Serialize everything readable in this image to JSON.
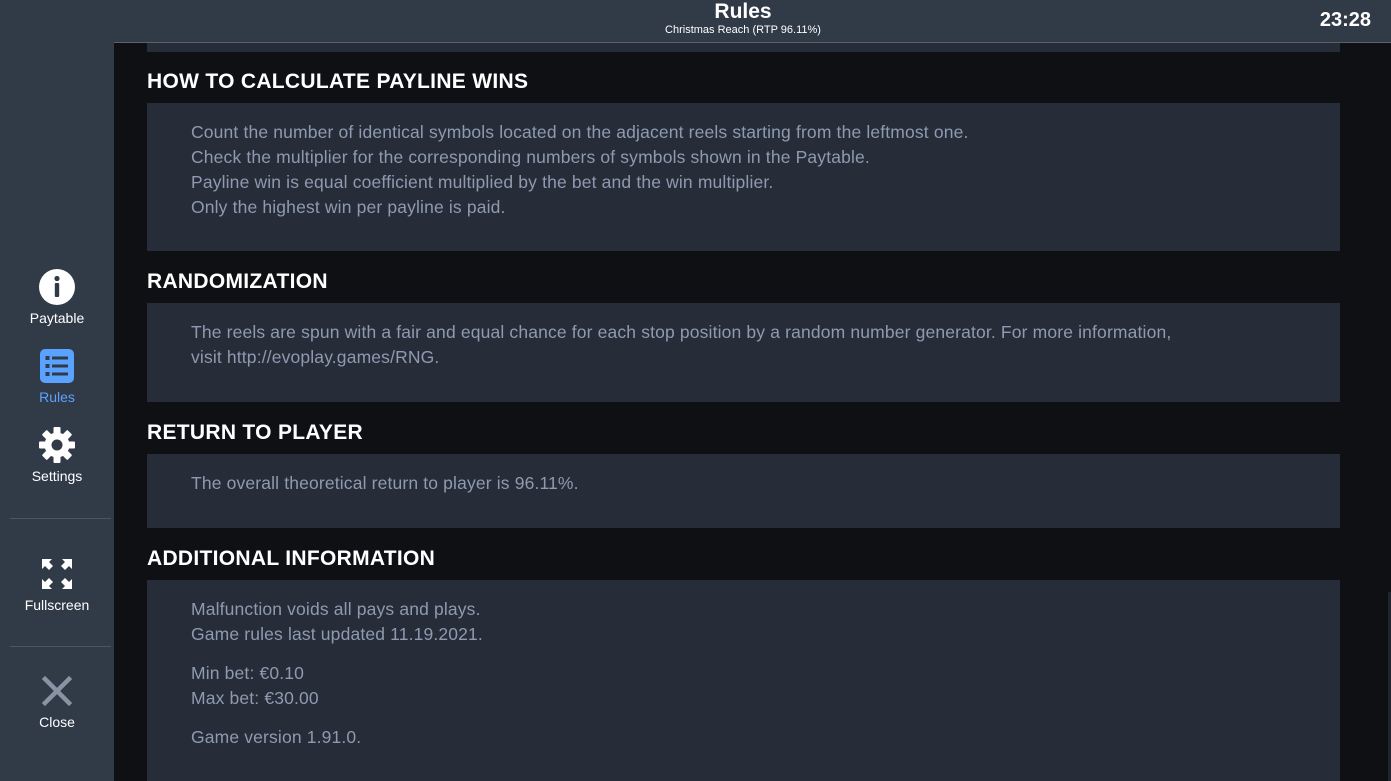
{
  "header": {
    "title": "Rules",
    "subtitle": "Christmas Reach (RTP 96.11%)",
    "clock": "23:28"
  },
  "sidebar": {
    "paytable": {
      "label": "Paytable",
      "icon": "info-icon"
    },
    "rules": {
      "label": "Rules",
      "icon": "list-icon",
      "active": true
    },
    "settings": {
      "label": "Settings",
      "icon": "gear-icon"
    },
    "fullscreen": {
      "label": "Fullscreen",
      "icon": "fullscreen-icon"
    },
    "close": {
      "label": "Close",
      "icon": "close-icon"
    }
  },
  "sections": {
    "payline": {
      "title": "HOW TO CALCULATE PAYLINE WINS",
      "lines": [
        "Count the number of identical symbols located on the adjacent reels starting from the leftmost one.",
        "Check the multiplier for the corresponding numbers of symbols shown in the Paytable.",
        "Payline win is equal coefficient multiplied by the bet and the win multiplier.",
        "Only the highest win per payline is paid."
      ]
    },
    "randomization": {
      "title": "RANDOMIZATION",
      "lines": [
        "The reels are spun with a fair and equal chance for each stop position by a random number generator. For more information,",
        "visit http://evoplay.games/RNG."
      ]
    },
    "rtp": {
      "title": "RETURN TO PLAYER",
      "lines": [
        "The overall theoretical return to player is 96.11%."
      ]
    },
    "additional": {
      "title": "ADDITIONAL INFORMATION",
      "lines": [
        "Malfunction voids all pays and plays.",
        "Game rules last updated 11.19.2021.",
        "Min bet: €0.10",
        "Max bet: €30.00",
        "Game version 1.91.0."
      ]
    }
  },
  "colors": {
    "sidebar_bg": "#313a47",
    "page_bg": "#0e1014",
    "panel_bg": "#262d38",
    "body_text": "#8f9ab0",
    "accent": "#5aa2ff"
  }
}
